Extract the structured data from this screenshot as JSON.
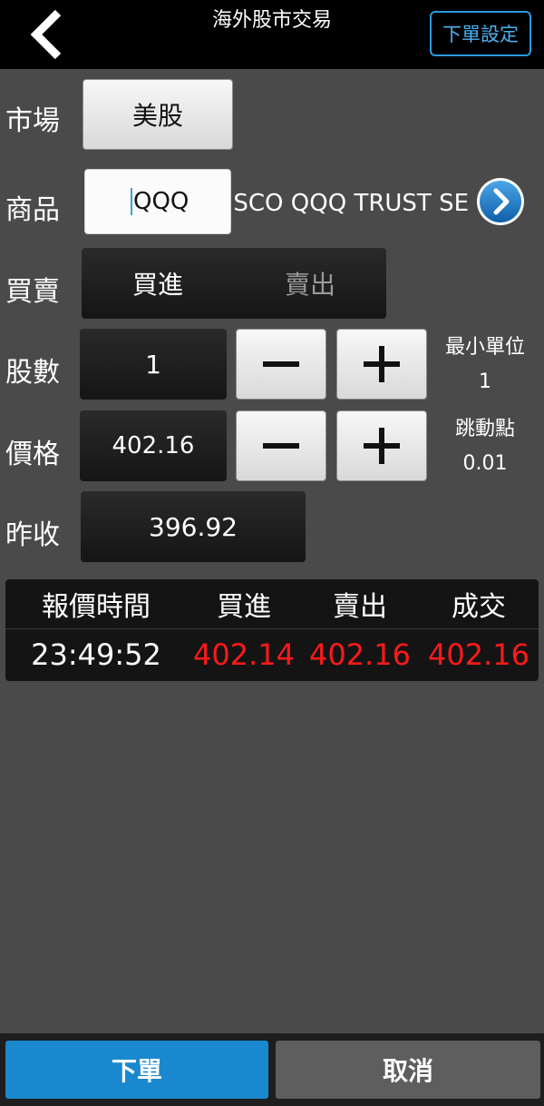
{
  "header": {
    "title": "海外股市交易",
    "settings_label": "下單設定",
    "back_icon": "chevron-left-icon"
  },
  "form": {
    "market": {
      "label": "市場",
      "value": "美股"
    },
    "product": {
      "label": "商品",
      "symbol": "QQQ",
      "name": "SCO QQQ TRUST SE",
      "go_icon": "chevron-right-circle-icon"
    },
    "side": {
      "label": "買賣",
      "buy": "買進",
      "sell": "賣出",
      "selected": "buy"
    },
    "shares": {
      "label": "股數",
      "value": "1",
      "min_unit_label": "最小單位",
      "min_unit_value": "1"
    },
    "price": {
      "label": "價格",
      "value": "402.16",
      "tick_label": "跳動點",
      "tick_value": "0.01"
    },
    "prev_close": {
      "label": "昨收",
      "value": "396.92"
    }
  },
  "quote": {
    "headers": [
      "報價時間",
      "買進",
      "賣出",
      "成交"
    ],
    "time": "23:49:52",
    "bid": "402.14",
    "ask": "402.16",
    "last": "402.16"
  },
  "colors": {
    "accent": "#1a88cf",
    "price_red": "#ff1a1a",
    "background": "#4a4a4a"
  },
  "footer": {
    "order_label": "下單",
    "cancel_label": "取消"
  }
}
